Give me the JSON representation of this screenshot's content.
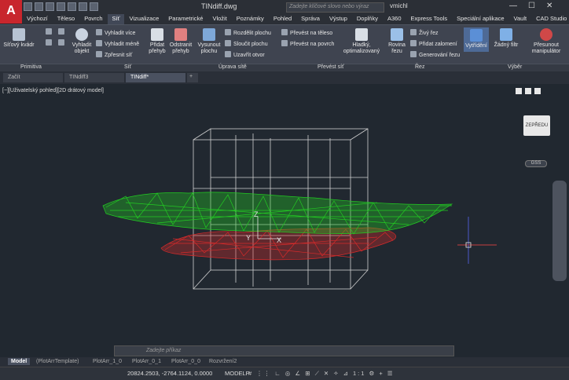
{
  "app": {
    "logo": "A",
    "title": "TINdiff.dwg",
    "search_placeholder": "Zadejte klíčové slovo nebo výraz",
    "user": "vmichl",
    "window_controls": [
      "—",
      "☐",
      "✕"
    ]
  },
  "menu": [
    "Výchozí",
    "Těleso",
    "Povrch",
    "Síť",
    "Vizualizace",
    "Parametrické",
    "Vložit",
    "Poznámky",
    "Pohled",
    "Správa",
    "Výstup",
    "Doplňky",
    "A360",
    "Express Tools",
    "Speciální aplikace",
    "Vault",
    "CAD Studio"
  ],
  "ribbon": {
    "buttons": [
      {
        "label": "Síťový kvádr",
        "color": "#b7c3d3"
      },
      {
        "label": "Vyhladit objekt",
        "color": "#c9d3e0"
      },
      {
        "label": "Přidat přehyb",
        "color": "#d9dfe6"
      },
      {
        "label": "Odstranit přehyb",
        "color": "#e08080"
      },
      {
        "label": "Vysunout plochu",
        "color": "#7ea8d8"
      },
      {
        "label": "Hladký, optimalizovaný",
        "color": "#d9dfe6"
      },
      {
        "label": "Rovina řezu",
        "color": "#9bc0e8"
      },
      {
        "label": "Vytřídění",
        "color": "#5b8fd6"
      },
      {
        "label": "Žádný filtr",
        "color": "#7fb0e6"
      },
      {
        "label": "Přesunout manipulátor",
        "color": "#d04848"
      }
    ],
    "small": [
      "Vyhladit více",
      "Vyhladit méně",
      "Zpřesnit síť",
      "Rozdělit plochu",
      "Sloučit plochu",
      "Uzavřít otvor",
      "Převést na těleso",
      "Převést na povrch",
      "Živý řez",
      "Přidat zalomení",
      "Generování řezu"
    ],
    "panels": [
      "Primitiva",
      "Síť",
      "Úprava sítě",
      "Převést síť",
      "Řez",
      "Výběr"
    ]
  },
  "doc_tabs": [
    "Začít",
    "TINdiff3",
    "TINdiff*"
  ],
  "viewport": {
    "label": "[−][Uživatelský pohled][2D drátový model]",
    "viewcube": "ZEPŘEDU",
    "wcs": "GSS"
  },
  "command": {
    "placeholder": "Zadejte příkaz"
  },
  "layout_tabs": [
    "Model",
    "(PlotArrTemplate)",
    "PlotArr_1_0",
    "PlotArr_0_1",
    "PlotArr_0_0",
    "Rozvržení2"
  ],
  "status": {
    "coords": "20824.2503, -2764.1124, 0.0000",
    "space": "MODELP",
    "icons": "# ⋮⋮ ∟ ◎ ∠ ⊞ ⟋ ✕ ✧ ⊿ 1:1 ⚙ + ☰"
  },
  "colors": {
    "green_mesh": "#22cc22",
    "red_mesh": "#d62a2a",
    "box": "#d0d0d0",
    "background": "#212830"
  }
}
